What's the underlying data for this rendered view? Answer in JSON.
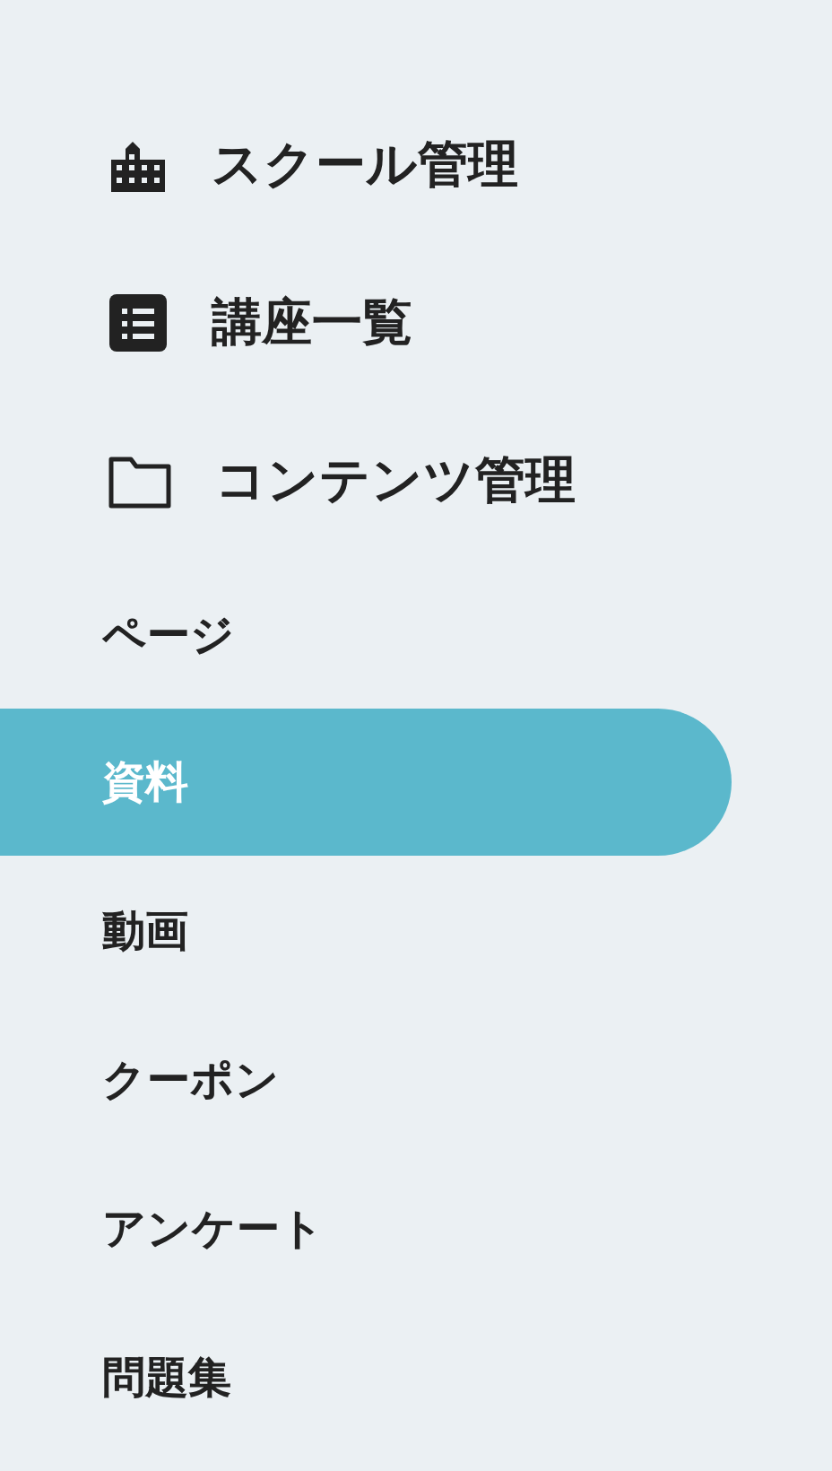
{
  "sections": [
    {
      "label": "スクール管理"
    },
    {
      "label": "講座一覧"
    },
    {
      "label": "コンテンツ管理",
      "children": [
        {
          "label": "ページ",
          "selected": false
        },
        {
          "label": "資料",
          "selected": true
        },
        {
          "label": "動画",
          "selected": false
        },
        {
          "label": "クーポン",
          "selected": false
        },
        {
          "label": "アンケート",
          "selected": false
        },
        {
          "label": "問題集",
          "selected": false
        }
      ]
    }
  ]
}
